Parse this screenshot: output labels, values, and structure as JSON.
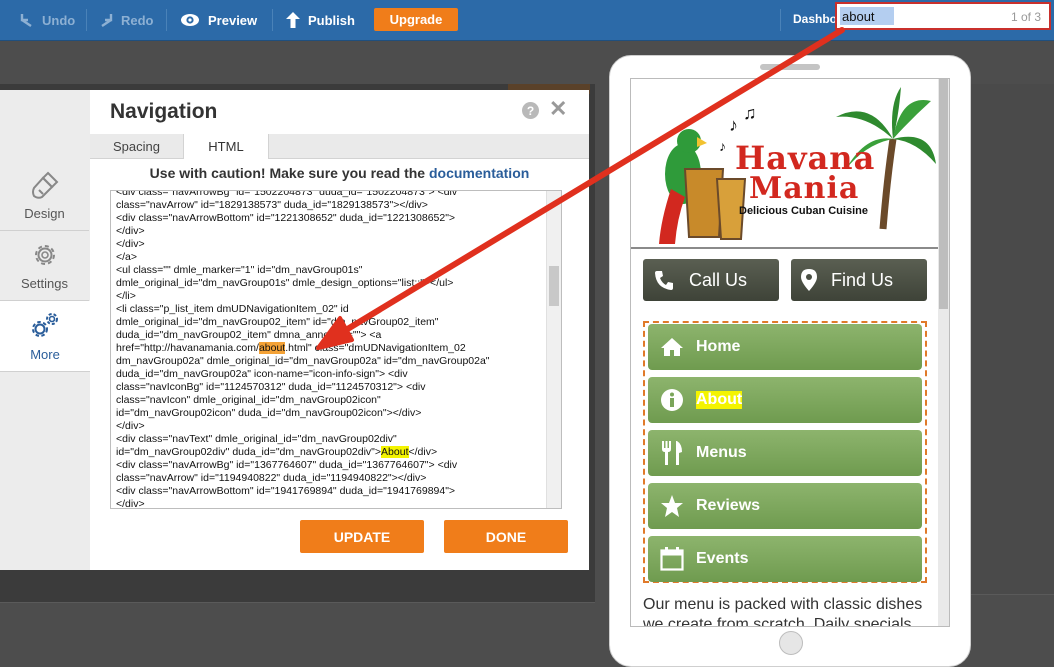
{
  "toolbar": {
    "undo_label": "Undo",
    "redo_label": "Redo",
    "preview_label": "Preview",
    "publish_label": "Publish",
    "upgrade_label": "Upgrade",
    "dashboard_label": "Dashbo",
    "find_value": "about",
    "find_count": "1 of 3"
  },
  "side_rail": {
    "items": [
      {
        "label": "Design",
        "icon": "brush-icon"
      },
      {
        "label": "Settings",
        "icon": "gear-icon"
      },
      {
        "label": "More",
        "icon": "gears-icon"
      }
    ]
  },
  "dialog": {
    "title": "Navigation",
    "help": "?",
    "tabs": [
      "Spacing",
      "HTML"
    ],
    "caution_prefix": "Use with caution! Make sure you read the ",
    "caution_link": "documentation",
    "update_label": "UPDATE",
    "done_label": "DONE",
    "code_lines": [
      " <div class=\"navArrowBg\" id=\"1502204873\" duda_id=\"1502204873\"> <div",
      "class=\"navArrow\" id=\"1829138573\" duda_id=\"1829138573\"></div>",
      " <div class=\"navArrowBottom\" id=\"1221308652\" duda_id=\"1221308652\">",
      "</div>",
      "</div>",
      "</a>",
      " <ul class=\"\" dmle_marker=\"1\" id=\"dm_navGroup01s\"",
      "dmle_original_id=\"dm_navGroup01s\" dmle_design_options=\"list:;\"></ul>",
      "</li>",
      " <li class=\"p_list_item dmUDNavigationItem_02\" id",
      "dmle_original_id=\"dm_navGroup02_item\" id=\"dm_navGroup02_item\"",
      "duda_id=\"dm_navGroup02_item\" dmna_annotate=\"\"> <a",
      "href=\"http://havanamania.com/",
      "dm_navGroup02a\" dmle_original_id=\"dm_navGroup02a\" id=\"dm_navGroup02a\"",
      "duda_id=\"dm_navGroup02a\" icon-name=\"icon-info-sign\"> <div",
      "class=\"navIconBg\" id=\"1124570312\" duda_id=\"1124570312\"> <div",
      "class=\"navIcon\" dmle_original_id=\"dm_navGroup02icon\"",
      "id=\"dm_navGroup02icon\" duda_id=\"dm_navGroup02icon\"></div>",
      "</div>",
      " <div class=\"navText\" dmle_original_id=\"dm_navGroup02div\"",
      "id=\"dm_navGroup02div\" duda_id=\"dm_navGroup02div\">",
      " <div class=\"navArrowBg\" id=\"1367764607\" duda_id=\"1367764607\"> <div",
      "class=\"navArrow\" id=\"1194940822\" duda_id=\"1194940822\"></div>",
      " <div class=\"navArrowBottom\" id=\"1941769894\" duda_id=\"1941769894\">",
      "</div>"
    ],
    "href_highlight": "about",
    "href_suffix": ".html\" class=\"dmUDNavigationItem_02",
    "navtext_highlight": "About",
    "navtext_suffix": "</div>"
  },
  "preview": {
    "logo_title_1": "Havana",
    "logo_title_2": "Mania",
    "logo_tagline": "Delicious Cuban Cuisine",
    "call_label": "Call Us",
    "find_label": "Find Us",
    "nav_items": [
      {
        "label": "Home",
        "icon": "home-icon"
      },
      {
        "label": "About",
        "icon": "info-icon"
      },
      {
        "label": "Menus",
        "icon": "utensils-icon"
      },
      {
        "label": "Reviews",
        "icon": "star-icon"
      },
      {
        "label": "Events",
        "icon": "calendar-icon"
      }
    ],
    "body_text": "Our menu is packed with classic dishes we create from scratch. Daily specials"
  }
}
